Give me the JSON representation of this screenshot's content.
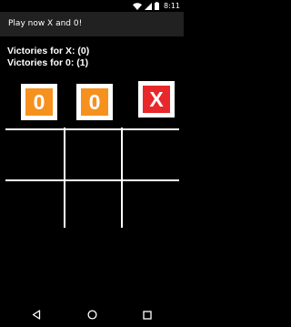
{
  "status_bar": {
    "time": "8:11",
    "icons": [
      "wifi-icon",
      "signal-icon",
      "battery-icon"
    ]
  },
  "app_bar": {
    "title": "Play now X and 0!"
  },
  "scores": {
    "x_label": "Victories for X: (0)",
    "o_label": "Victories for 0: (1)"
  },
  "header_tiles": [
    {
      "symbol": "0",
      "color": "#f6911e"
    },
    {
      "symbol": "0",
      "color": "#f6911e"
    },
    {
      "symbol": "X",
      "color": "#e8282b"
    }
  ],
  "board": {
    "cells": [
      "",
      "",
      "",
      "",
      "",
      ""
    ]
  },
  "nav_bar": {
    "icons": [
      "back-icon",
      "home-icon",
      "recents-icon"
    ]
  },
  "colors": {
    "background": "#000000",
    "app_bar": "#212121",
    "tile_o": "#f6911e",
    "tile_x": "#e8282b",
    "grid": "#ffffff"
  }
}
